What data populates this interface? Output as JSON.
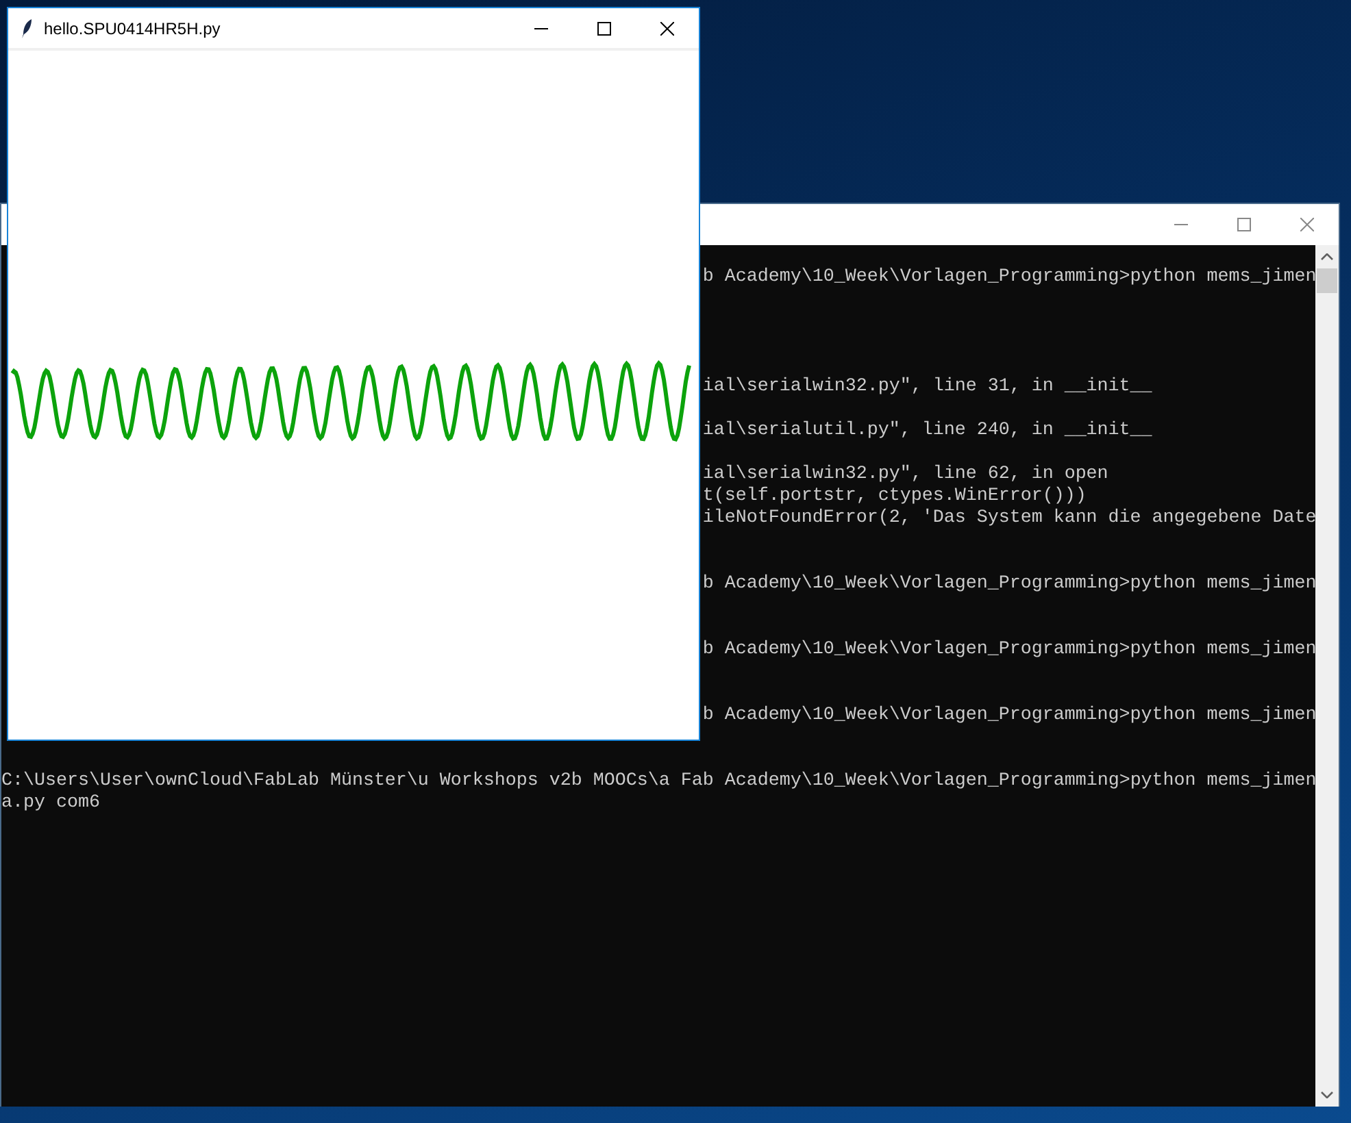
{
  "console_window": {
    "lines": [
      {
        "kind": "tail",
        "text": "b Academy\\10_Week\\Vorlagen_Programming>python mems_jimen"
      },
      {
        "kind": "tail",
        "text": "ial\\serialwin32.py\", line 31, in __init__"
      },
      {
        "kind": "tail",
        "text": "ial\\serialutil.py\", line 240, in __init__"
      },
      {
        "kind": "tail",
        "text": "ial\\serialwin32.py\", line 62, in open"
      },
      {
        "kind": "tail",
        "text": "t(self.portstr, ctypes.WinError()))"
      },
      {
        "kind": "tail",
        "text": "ileNotFoundError(2, 'Das System kann die angegebene Date"
      },
      {
        "kind": "tail",
        "text": "b Academy\\10_Week\\Vorlagen_Programming>python mems_jimen"
      },
      {
        "kind": "tail",
        "text": "b Academy\\10_Week\\Vorlagen_Programming>python mems_jimen"
      },
      {
        "kind": "tail",
        "text": "b Academy\\10_Week\\Vorlagen_Programming>python mems_jimen"
      },
      {
        "kind": "full",
        "text": "C:\\Users\\User\\ownCloud\\FabLab Münster\\u Workshops v2b MOOCs\\a Fab Academy\\10_Week\\Vorlagen_Programming>python mems_jimen"
      },
      {
        "kind": "full",
        "text": "a.py com6"
      }
    ]
  },
  "plot_window": {
    "title": "hello.SPU0414HR5H.py"
  }
}
